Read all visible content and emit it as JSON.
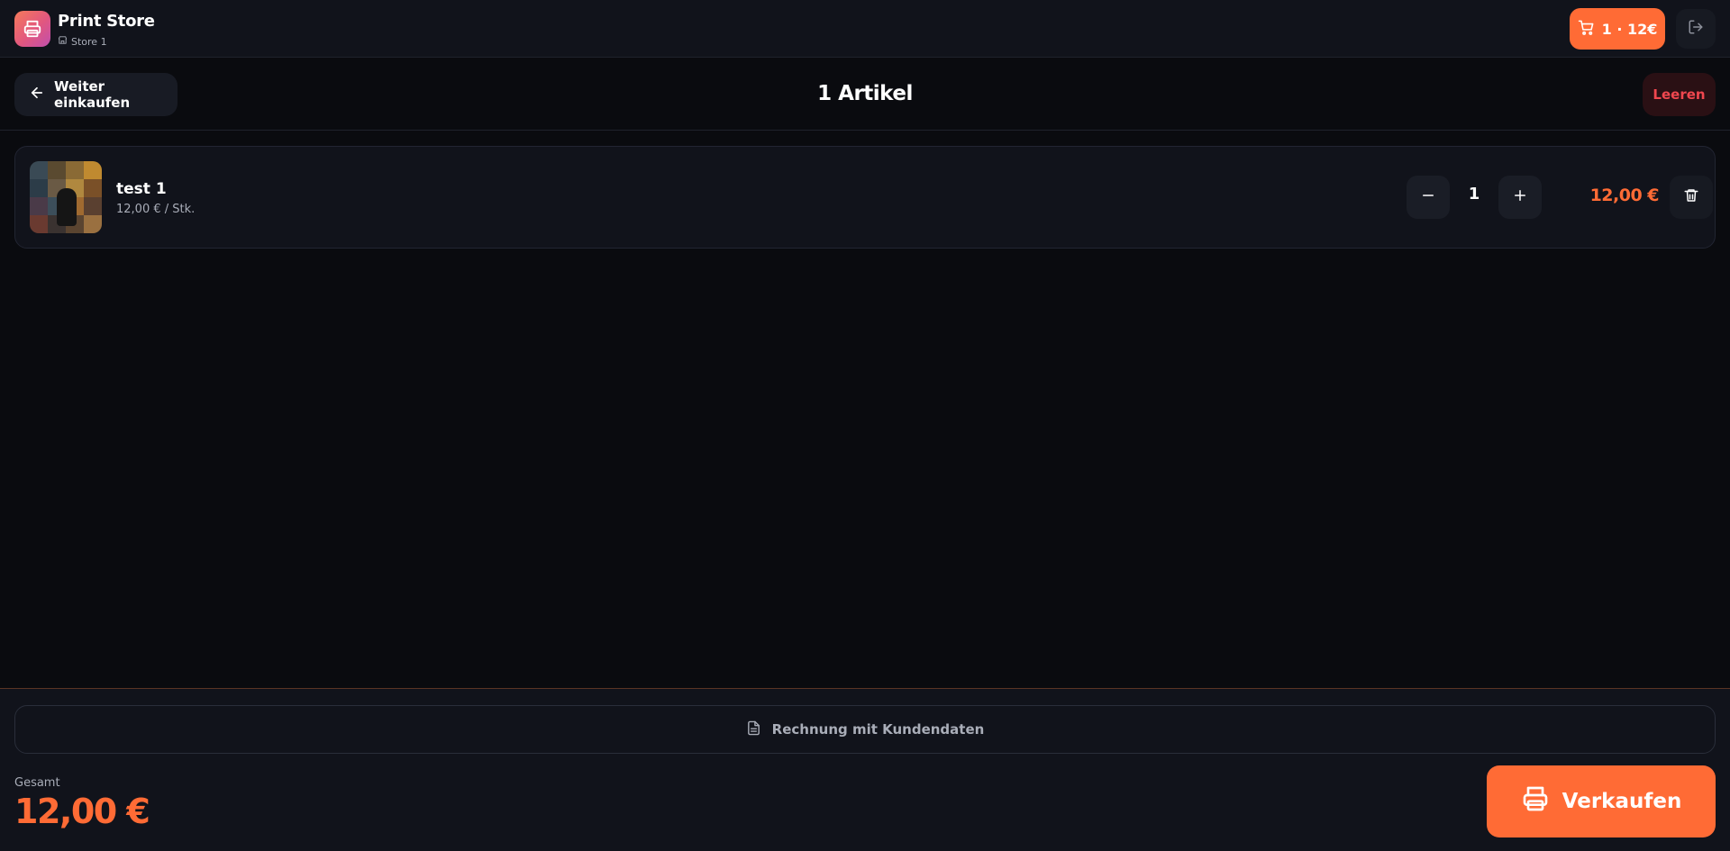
{
  "header": {
    "brand_name": "Print Store",
    "store_name": "Store 1",
    "cart_summary": "1 · 12€"
  },
  "subbar": {
    "back_label": "Weiter einkaufen",
    "title": "1 Artikel",
    "clear_label": "Leeren"
  },
  "cart": {
    "items": [
      {
        "name": "test 1",
        "unit_price": "12,00 € / Stk.",
        "quantity": "1",
        "total": "12,00 €"
      }
    ]
  },
  "footer": {
    "invoice_label": "Rechnung mit Kundendaten",
    "total_label": "Gesamt",
    "total_value": "12,00 €",
    "sell_label": "Verkaufen"
  },
  "colors": {
    "accent": "#ff6b35",
    "danger": "#f0474f",
    "background": "#0a0b0f",
    "surface": "#11131b"
  },
  "icons": {
    "logo": "printer-icon",
    "store": "store-icon",
    "cart": "cart-icon",
    "logout": "logout-icon",
    "back": "arrow-left-icon",
    "minus": "minus-icon",
    "plus": "plus-icon",
    "delete": "trash-icon",
    "invoice": "document-icon",
    "sell": "printer-icon"
  }
}
